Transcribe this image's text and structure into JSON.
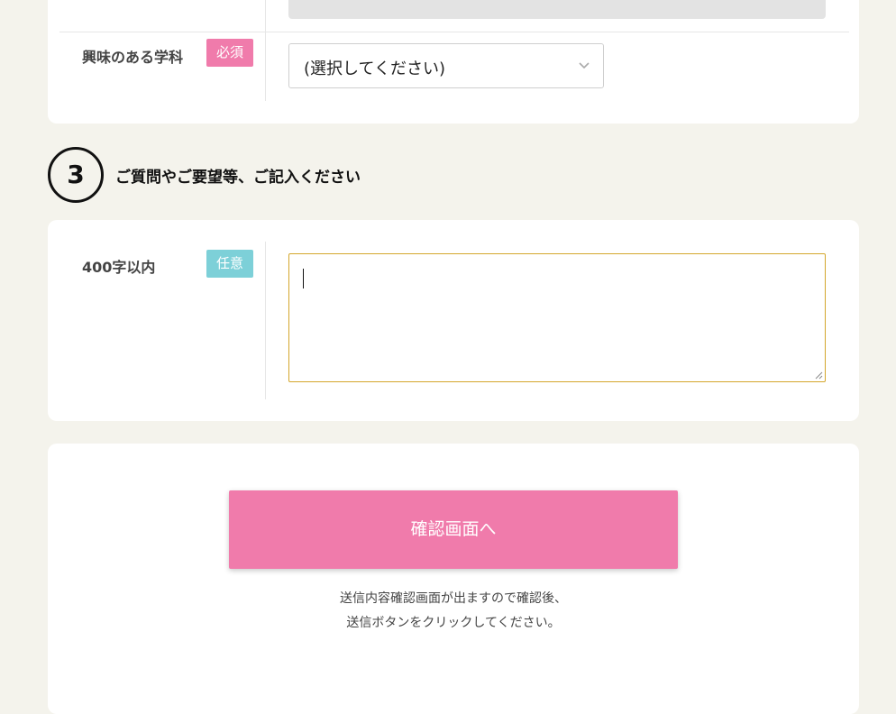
{
  "interest_row": {
    "label": "興味のある学科",
    "badge": "必須",
    "select": {
      "selected": "(選択してください)"
    }
  },
  "section3": {
    "number": "3",
    "title": "ご質問やご要望等、ご記入ください"
  },
  "comment_row": {
    "label": "400字以内",
    "badge": "任意",
    "value": ""
  },
  "submit": {
    "button_label": "確認画面へ",
    "note_line1": "送信内容確認画面が出ますので確認後、",
    "note_line2": "送信ボタンをクリックしてください。"
  },
  "colors": {
    "required_badge": "#f07bab",
    "optional_badge": "#7dd0d8",
    "submit_button": "#f07bab",
    "textarea_focus_border": "#d4a72c",
    "page_background": "#f4f3ec"
  },
  "icons": {
    "select": "chevron-down-icon",
    "textarea": "resize-grip-icon"
  }
}
